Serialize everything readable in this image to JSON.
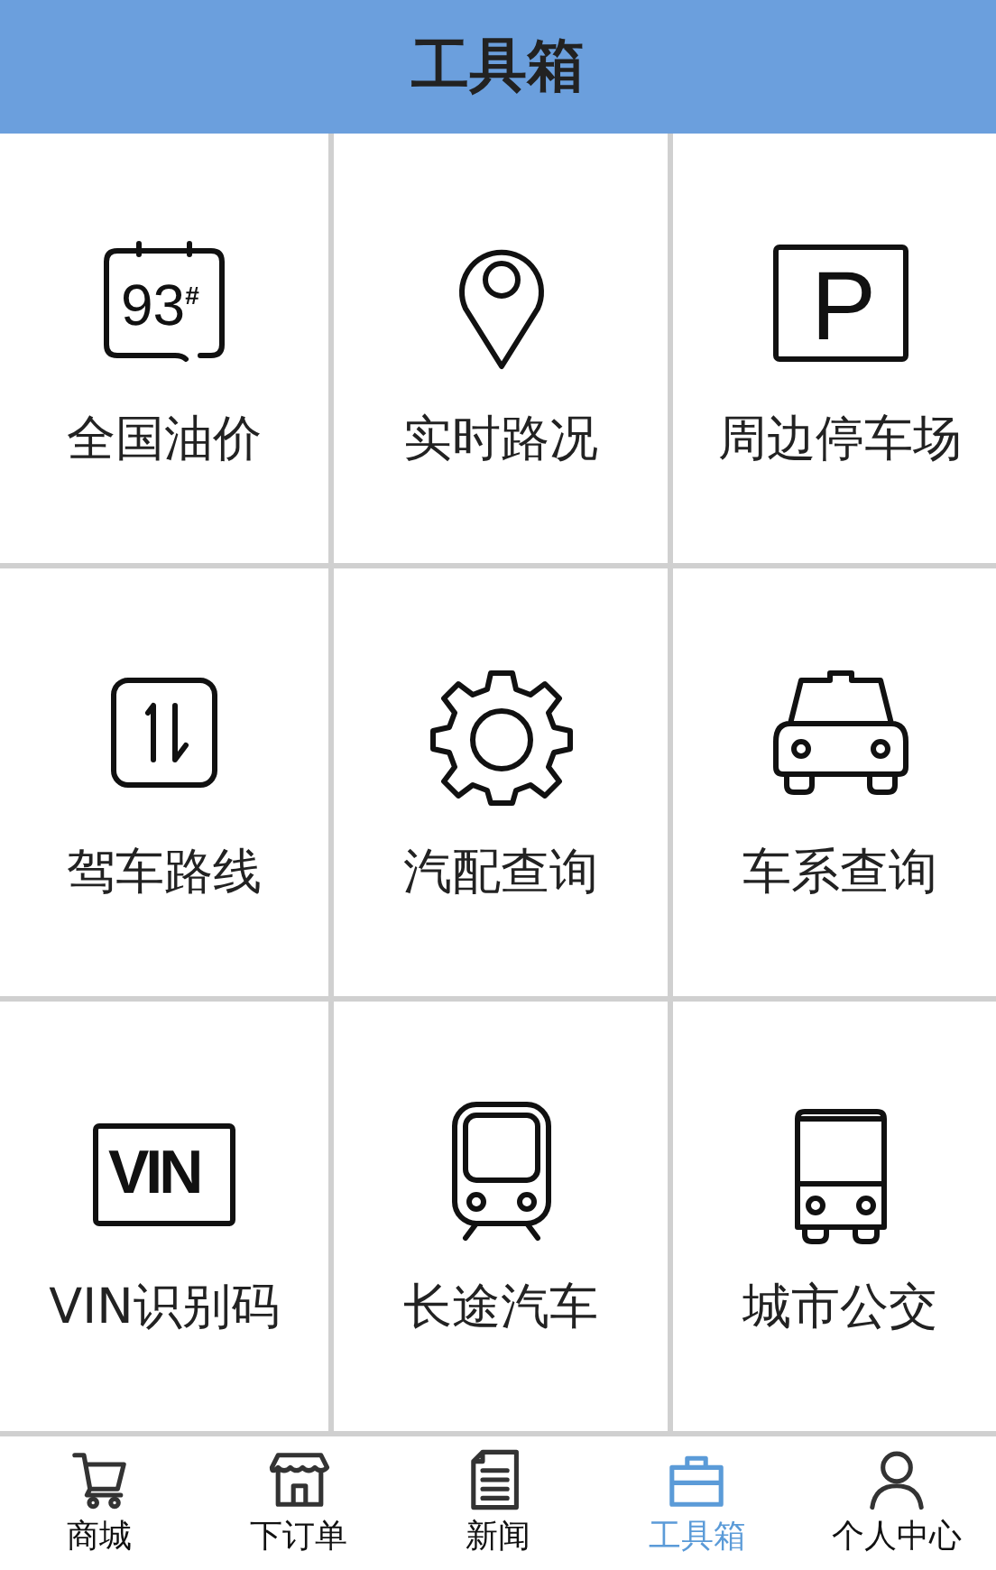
{
  "header": {
    "title": "工具箱"
  },
  "tiles": [
    {
      "label": "全国油价",
      "kind": "oil",
      "icon_text": "93$^{#}$"
    },
    {
      "label": "实时路况",
      "kind": "pin"
    },
    {
      "label": "周边停车场",
      "kind": "parking",
      "icon_text": "P"
    },
    {
      "label": "驾车路线",
      "kind": "updown"
    },
    {
      "label": "汽配查询",
      "kind": "gear"
    },
    {
      "label": "车系查询",
      "kind": "taxi"
    },
    {
      "label": "VIN识别码",
      "kind": "vin",
      "icon_text": "VIN"
    },
    {
      "label": "长途汽车",
      "kind": "train"
    },
    {
      "label": "城市公交",
      "kind": "bus"
    }
  ],
  "nav": [
    {
      "label": "商城",
      "kind": "cart",
      "selected": false
    },
    {
      "label": "下订单",
      "kind": "shop",
      "selected": false
    },
    {
      "label": "新闻",
      "kind": "doc",
      "selected": false
    },
    {
      "label": "工具箱",
      "kind": "case",
      "selected": true
    },
    {
      "label": "个人中心",
      "kind": "person",
      "selected": false
    }
  ]
}
